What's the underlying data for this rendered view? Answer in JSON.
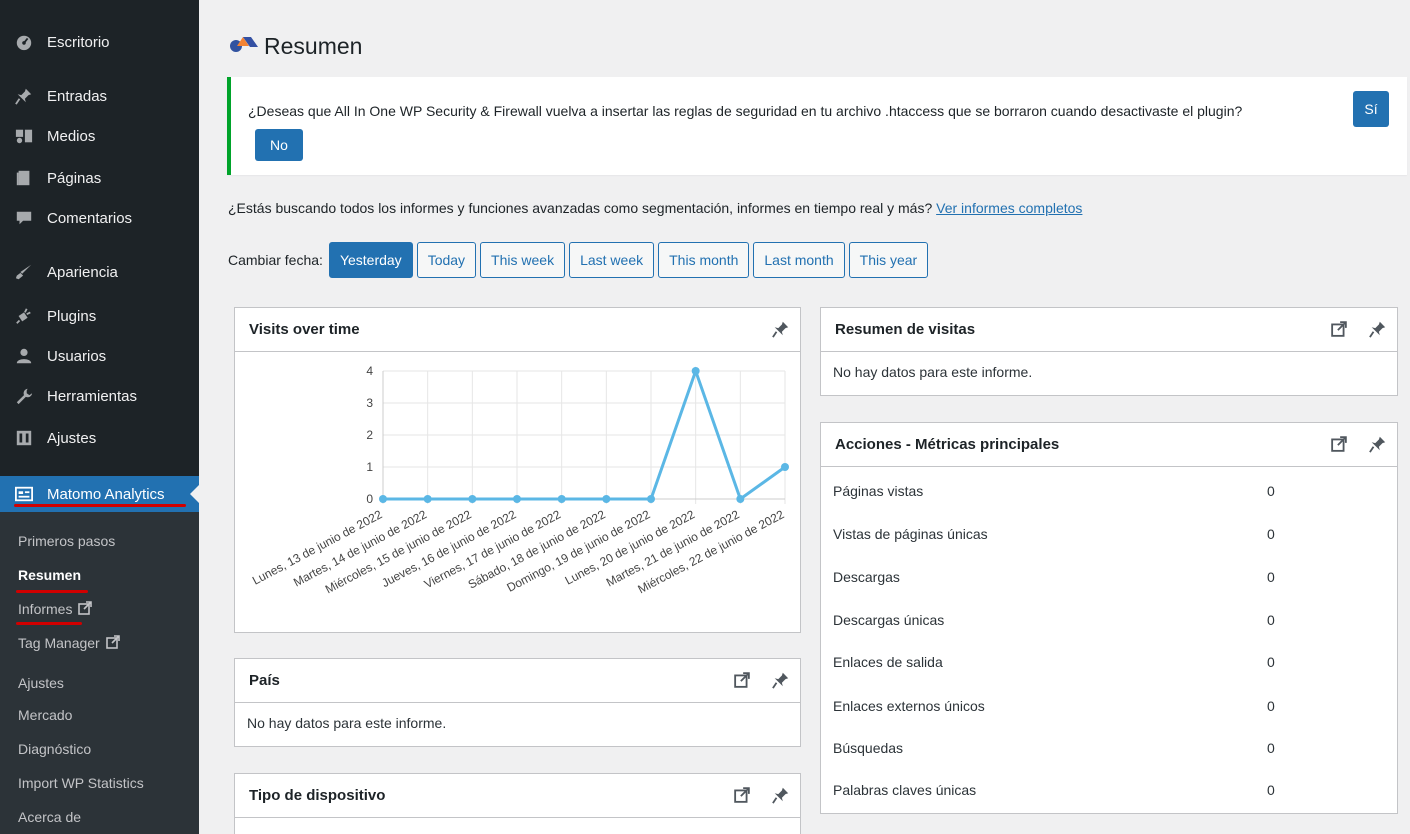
{
  "sidebar": {
    "items": [
      {
        "label": "Escritorio",
        "icon": "dashboard-icon"
      },
      {
        "label": "Entradas",
        "icon": "pin-icon"
      },
      {
        "label": "Medios",
        "icon": "media-icon"
      },
      {
        "label": "Páginas",
        "icon": "pages-icon"
      },
      {
        "label": "Comentarios",
        "icon": "comments-icon"
      },
      {
        "label": "Apariencia",
        "icon": "appearance-icon"
      },
      {
        "label": "Plugins",
        "icon": "plugins-icon"
      },
      {
        "label": "Usuarios",
        "icon": "users-icon"
      },
      {
        "label": "Herramientas",
        "icon": "tools-icon"
      },
      {
        "label": "Ajustes",
        "icon": "settings-icon"
      },
      {
        "label": "Matomo Analytics",
        "icon": "matomo-icon"
      }
    ],
    "submenu": [
      {
        "label": "Primeros pasos"
      },
      {
        "label": "Resumen"
      },
      {
        "label": "Informes"
      },
      {
        "label": "Tag Manager"
      },
      {
        "label": "Ajustes"
      },
      {
        "label": "Mercado"
      },
      {
        "label": "Diagnóstico"
      },
      {
        "label": "Import WP Statistics"
      },
      {
        "label": "Acerca de"
      }
    ]
  },
  "page": {
    "title": "Resumen"
  },
  "notice": {
    "text": "¿Deseas que All In One WP Security & Firewall vuelva a insertar las reglas de seguridad en tu archivo .htaccess que se borraron cuando desactivaste el plugin?",
    "yes_label": "Sí",
    "no_label": "No"
  },
  "promo": {
    "text": "¿Estás buscando todos los informes y funciones avanzadas como segmentación, informes en tiempo real y más? ",
    "link": "Ver informes completos"
  },
  "date_selector": {
    "label": "Cambiar fecha:",
    "options": [
      "Yesterday",
      "Today",
      "This week",
      "Last week",
      "This month",
      "Last month",
      "This year"
    ],
    "selected": "Yesterday"
  },
  "widgets": {
    "visits": {
      "title": "Visits over time"
    },
    "pais": {
      "title": "País",
      "empty": "No hay datos para este informe."
    },
    "dispositivo": {
      "title": "Tipo de dispositivo"
    },
    "resumen_visitas": {
      "title": "Resumen de visitas",
      "empty": "No hay datos para este informe."
    },
    "acciones": {
      "title": "Acciones - Métricas principales",
      "rows": [
        {
          "label": "Páginas vistas",
          "value": "0"
        },
        {
          "label": "Vistas de páginas únicas",
          "value": "0"
        },
        {
          "label": "Descargas",
          "value": "0"
        },
        {
          "label": "Descargas únicas",
          "value": "0"
        },
        {
          "label": "Enlaces de salida",
          "value": "0"
        },
        {
          "label": "Enlaces externos únicos",
          "value": "0"
        },
        {
          "label": "Búsquedas",
          "value": "0"
        },
        {
          "label": "Palabras claves únicas",
          "value": "0"
        }
      ]
    }
  },
  "chart_data": {
    "type": "line",
    "title": "Visits over time",
    "x": [
      "Lunes, 13 de junio de 2022",
      "Martes, 14 de junio de 2022",
      "Miércoles, 15 de junio de 2022",
      "Jueves, 16 de junio de 2022",
      "Viernes, 17 de junio de 2022",
      "Sábado, 18 de junio de 2022",
      "Domingo, 19 de junio de 2022",
      "Lunes, 20 de junio de 2022",
      "Martes, 21 de junio de 2022",
      "Miércoles, 22 de junio de 2022"
    ],
    "series": [
      {
        "values": [
          0,
          0,
          0,
          0,
          0,
          0,
          0,
          4,
          0,
          1
        ],
        "color": "#5bb7e5"
      }
    ],
    "yticks": [
      "0",
      "1",
      "2",
      "3",
      "4"
    ],
    "ylim": [
      0,
      4
    ],
    "grid": true
  },
  "colors": {
    "sidebar_bg": "#1d2327",
    "accent": "#2271b1",
    "notice_border": "#00a32a",
    "highlight_underline": "#d10000"
  }
}
